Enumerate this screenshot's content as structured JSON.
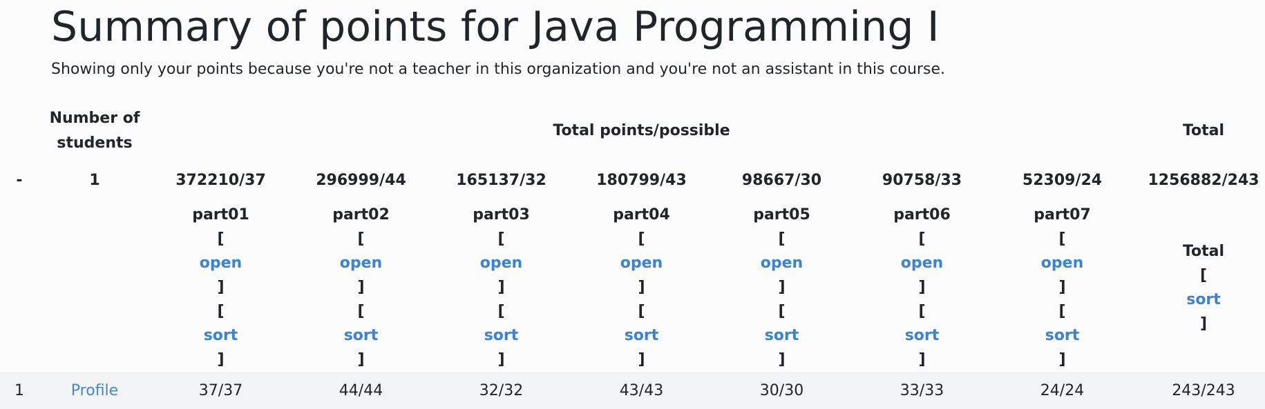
{
  "title": "Summary of points for Java Programming I",
  "subtitle": "Showing only your points because you're not a teacher in this organization and you're not an assistant in this course.",
  "header": {
    "number_of_students": "Number of students",
    "total_points_possible": "Total points/possible",
    "total": "Total"
  },
  "summary_row": {
    "dash": "-",
    "student_count": "1",
    "parts": [
      "372210/37",
      "296999/44",
      "165137/32",
      "180799/43",
      "98667/30",
      "90758/33",
      "52309/24"
    ],
    "total": "1256882/243"
  },
  "parts_row": {
    "parts": [
      {
        "name": "part01",
        "open": "open",
        "sort": "sort"
      },
      {
        "name": "part02",
        "open": "open",
        "sort": "sort"
      },
      {
        "name": "part03",
        "open": "open",
        "sort": "sort"
      },
      {
        "name": "part04",
        "open": "open",
        "sort": "sort"
      },
      {
        "name": "part05",
        "open": "open",
        "sort": "sort"
      },
      {
        "name": "part06",
        "open": "open",
        "sort": "sort"
      },
      {
        "name": "part07",
        "open": "open",
        "sort": "sort"
      }
    ],
    "total_label": "Total",
    "total_sort": "sort",
    "bracket_open": "[",
    "bracket_close": "]"
  },
  "student_rows": [
    {
      "index": "1",
      "profile": "Profile",
      "parts": [
        "37/37",
        "44/44",
        "32/32",
        "43/43",
        "30/30",
        "33/33",
        "24/24"
      ],
      "total": "243/243"
    }
  ],
  "colors": {
    "link": "#3a82d2",
    "text": "#212529",
    "row_bg": "#f2f3f5"
  }
}
